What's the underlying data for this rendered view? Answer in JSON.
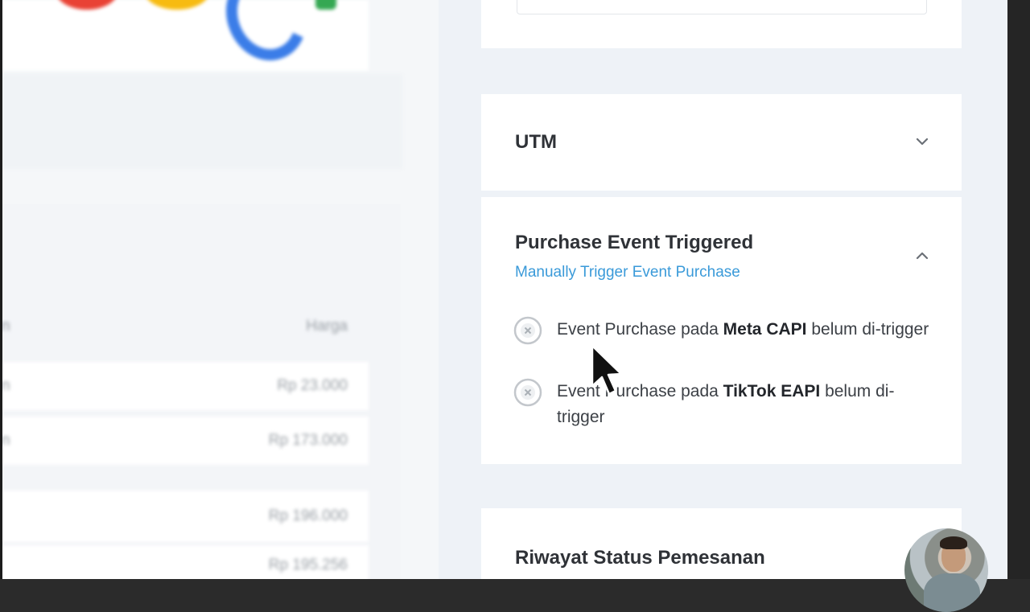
{
  "utm": {
    "title": "UTM"
  },
  "purchase": {
    "title": "Purchase Event Triggered",
    "subtitle_link": "Manually Trigger Event Purchase",
    "events": [
      {
        "prefix": "Event Purchase pada ",
        "platform": "Meta CAPI",
        "suffix": " belum di-trigger"
      },
      {
        "prefix": "Event Purchase pada ",
        "platform": "TikTok EAPI",
        "suffix": " belum di-trigger"
      }
    ]
  },
  "riwayat": {
    "title": "Riwayat Status Pemesanan"
  },
  "order_table": {
    "header": {
      "left": "n",
      "price": "Harga"
    },
    "rows": [
      {
        "left": "n",
        "price": "Rp 23.000"
      },
      {
        "left": "n",
        "price": "Rp 173.000"
      },
      {
        "left": "",
        "price": "Rp 196.000"
      },
      {
        "left": "",
        "price": "Rp 195.256"
      }
    ]
  },
  "colors": {
    "link": "#3a9ad9",
    "icon_grey": "#b9bec4",
    "card_bg": "#ffffff",
    "page_bg": "#eef2f7"
  },
  "icons": {
    "chevron_utm": "chevron-down-icon",
    "chevron_purchase": "chevron-up-icon",
    "event_status": "x-circle-icon"
  }
}
